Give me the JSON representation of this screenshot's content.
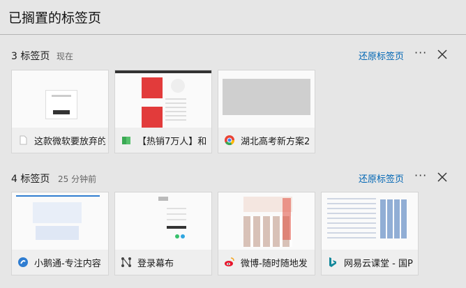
{
  "panel": {
    "title": "已搁置的标签页"
  },
  "groups": [
    {
      "count_label": "3 标签页",
      "time_label": "现在",
      "restore_label": "还原标签页",
      "more_label": "···",
      "tabs": [
        {
          "title": "这款微软要放弃的",
          "icon": "blank-page-icon"
        },
        {
          "title": "【热销7万人】和",
          "icon": "green-book-icon"
        },
        {
          "title": "湖北高考新方案2",
          "icon": "chrome-icon"
        }
      ]
    },
    {
      "count_label": "4 标签页",
      "time_label": "25 分钟前",
      "restore_label": "还原标签页",
      "more_label": "···",
      "tabs": [
        {
          "title": "小鹅通-专注内容",
          "icon": "xiaoe-icon"
        },
        {
          "title": "登录幕布",
          "icon": "mubu-icon"
        },
        {
          "title": "微博-随时随地发",
          "icon": "weibo-icon"
        },
        {
          "title": "网易云课堂 - 国P",
          "icon": "bing-icon"
        }
      ]
    }
  ],
  "colors": {
    "link": "#0066b4",
    "background": "#e6e6e6",
    "card_footer": "#efefef"
  }
}
